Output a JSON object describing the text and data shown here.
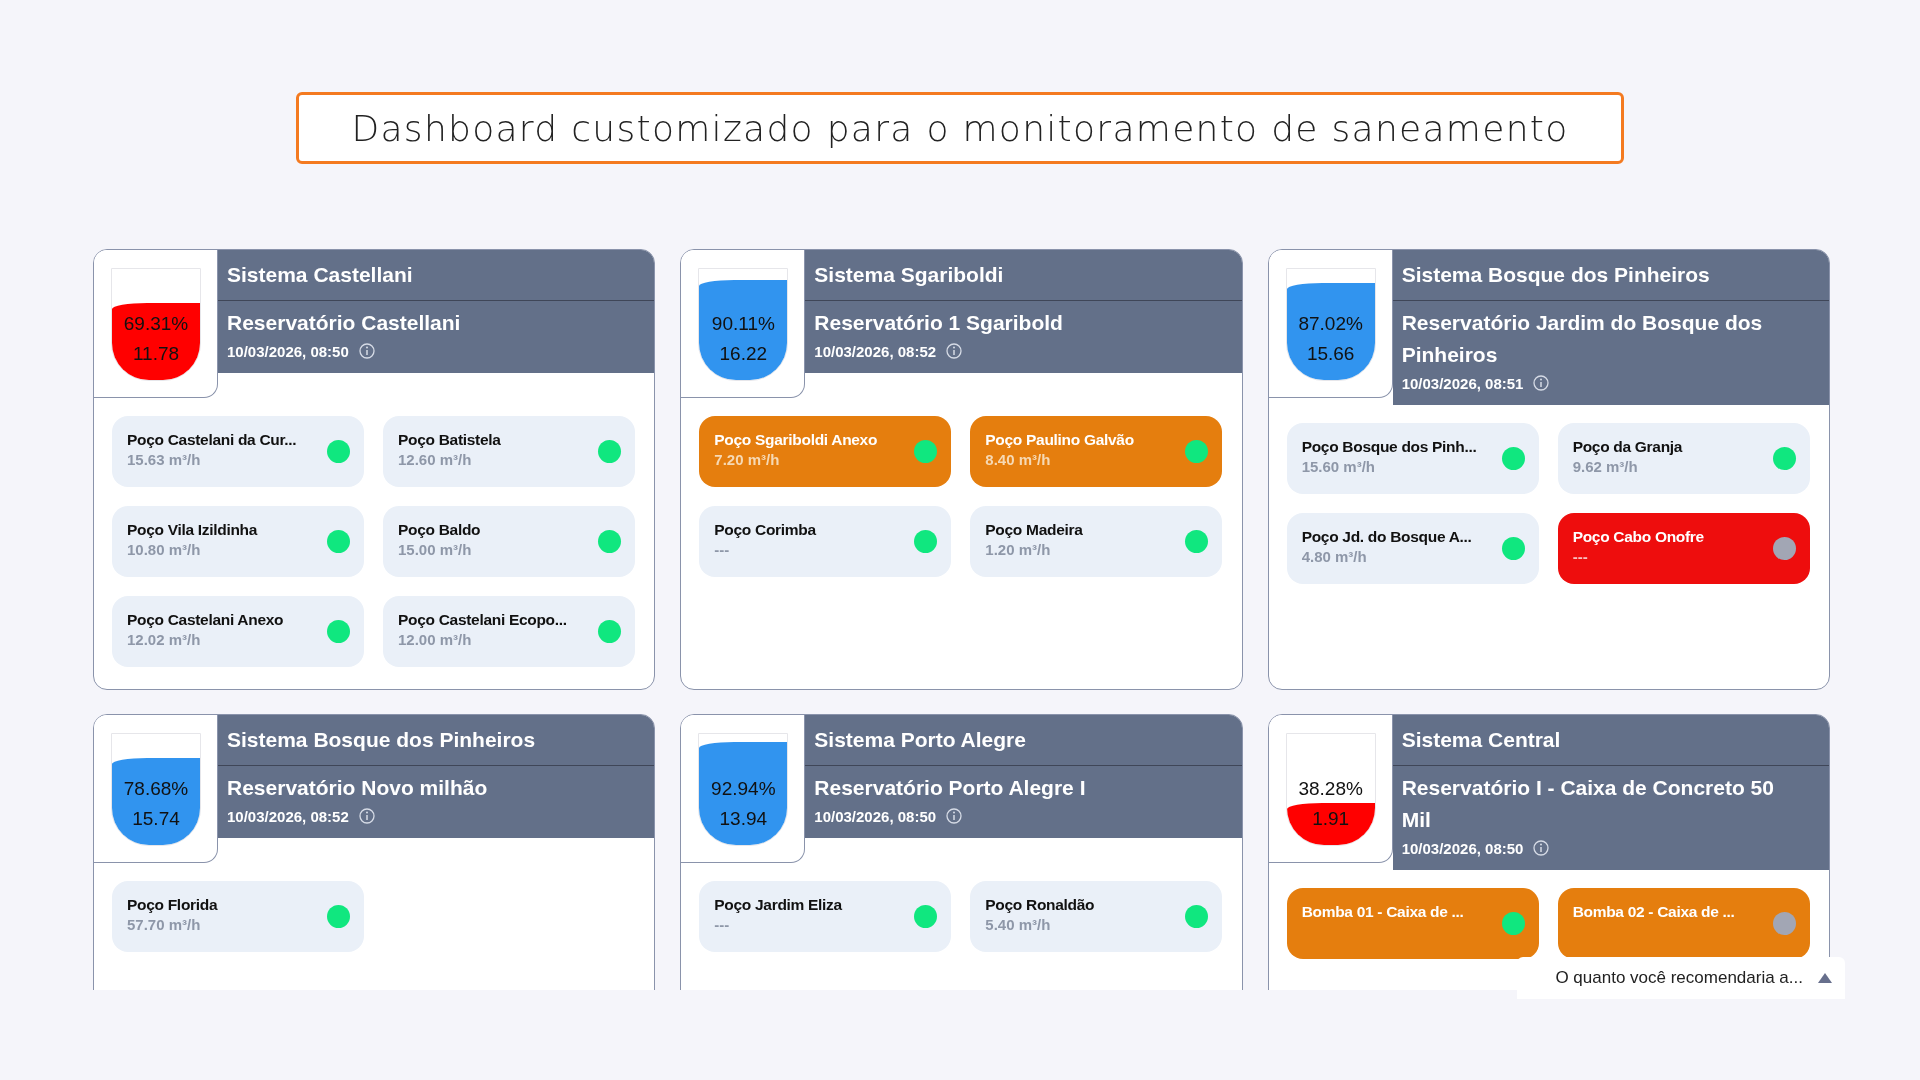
{
  "title": "Dashboard customizado para o monitoramento de saneamento",
  "systems": [
    {
      "system": "Sistema Castellani",
      "reservoir": "Reservatório Castellani",
      "timestamp": "10/03/2026, 08:50",
      "gauge": {
        "level": 0.6931,
        "low": true,
        "percent": "69.31%",
        "value": "11.78"
      },
      "wells": [
        {
          "name": "Poço Castelani da Cur...",
          "reading": "15.63 m³/h",
          "kind": "normal",
          "online": true
        },
        {
          "name": "Poço Batistela",
          "reading": "12.60 m³/h",
          "kind": "normal",
          "online": true
        },
        {
          "name": "Poço Vila Izildinha",
          "reading": "10.80 m³/h",
          "kind": "normal",
          "online": true
        },
        {
          "name": "Poço Baldo",
          "reading": "15.00 m³/h",
          "kind": "normal",
          "online": true
        },
        {
          "name": "Poço Castelani Anexo",
          "reading": "12.02 m³/h",
          "kind": "normal",
          "online": true
        },
        {
          "name": "Poço Castelani Ecopo...",
          "reading": "12.00 m³/h",
          "kind": "normal",
          "online": true
        }
      ]
    },
    {
      "system": "Sistema Sgariboldi",
      "reservoir": "Reservatório 1 Sgaribold",
      "timestamp": "10/03/2026, 08:52",
      "gauge": {
        "level": 0.9011,
        "low": false,
        "percent": "90.11%",
        "value": "16.22"
      },
      "wells": [
        {
          "name": "Poço Sgariboldi Anexo",
          "reading": "7.20 m³/h",
          "kind": "warning",
          "online": true
        },
        {
          "name": "Poço Paulino Galvão",
          "reading": "8.40 m³/h",
          "kind": "warning",
          "online": true
        },
        {
          "name": "Poço Corimba",
          "reading": "---",
          "kind": "normal",
          "online": true
        },
        {
          "name": "Poço Madeira",
          "reading": "1.20 m³/h",
          "kind": "normal",
          "online": true
        }
      ]
    },
    {
      "system": "Sistema Bosque dos Pinheiros",
      "reservoir": "Reservatório Jardim do Bosque dos Pinheiros",
      "timestamp": "10/03/2026, 08:51",
      "gauge": {
        "level": 0.8702,
        "low": false,
        "percent": "87.02%",
        "value": "15.66"
      },
      "wells": [
        {
          "name": "Poço Bosque dos Pinh...",
          "reading": "15.60 m³/h",
          "kind": "normal",
          "online": true
        },
        {
          "name": "Poço da Granja",
          "reading": "9.62 m³/h",
          "kind": "normal",
          "online": true
        },
        {
          "name": "Poço Jd. do Bosque A...",
          "reading": "4.80 m³/h",
          "kind": "normal",
          "online": true
        },
        {
          "name": "Poço Cabo Onofre",
          "reading": "---",
          "kind": "alarm",
          "online": false
        }
      ]
    },
    {
      "system": "Sistema Bosque dos Pinheiros",
      "reservoir": "Reservatório Novo milhão",
      "timestamp": "10/03/2026, 08:52",
      "gauge": {
        "level": 0.7868,
        "low": false,
        "percent": "78.68%",
        "value": "15.74"
      },
      "wells": [
        {
          "name": "Poço Florida",
          "reading": "57.70 m³/h",
          "kind": "normal",
          "online": true
        }
      ]
    },
    {
      "system": "Sistema Porto Alegre",
      "reservoir": "Reservatório Porto Alegre I",
      "timestamp": "10/03/2026, 08:50",
      "gauge": {
        "level": 0.9294,
        "low": false,
        "percent": "92.94%",
        "value": "13.94"
      },
      "wells": [
        {
          "name": "Poço Jardim Eliza",
          "reading": "---",
          "kind": "normal",
          "online": true
        },
        {
          "name": "Poço Ronaldão",
          "reading": "5.40 m³/h",
          "kind": "normal",
          "online": true
        }
      ]
    },
    {
      "system": "Sistema Central",
      "reservoir": "Reservatório I - Caixa de Concreto 50 Mil",
      "timestamp": "10/03/2026, 08:50",
      "gauge": {
        "level": 0.3828,
        "low": true,
        "percent": "38.28%",
        "value": "1.91"
      },
      "wells": [
        {
          "name": "Bomba 01 - Caixa de ...",
          "kind": "warning",
          "online": true
        },
        {
          "name": "Bomba 02 - Caixa de ...",
          "kind": "warning",
          "online": false
        }
      ]
    }
  ],
  "feedback": {
    "label": "O quanto você recomendaria a..."
  }
}
